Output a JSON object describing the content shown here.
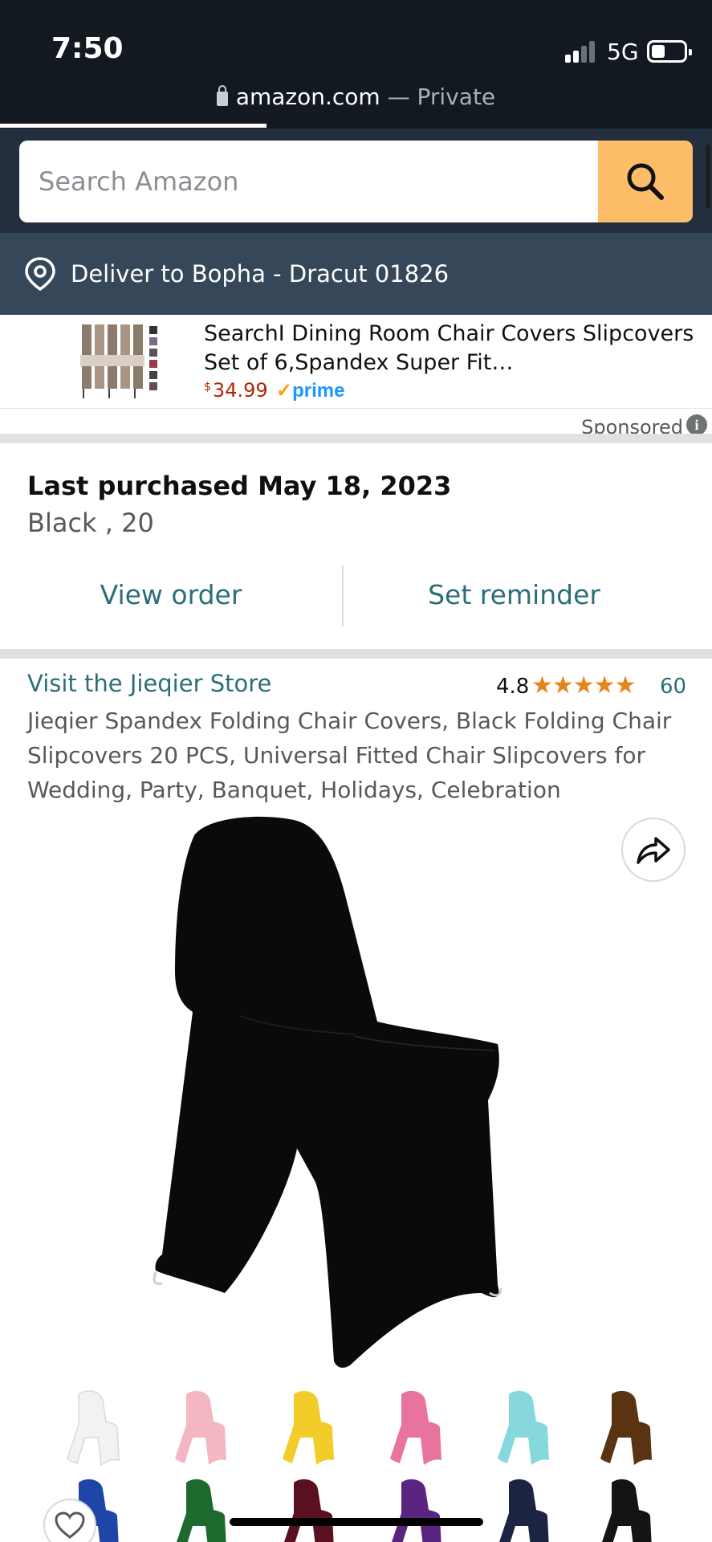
{
  "status_bar": {
    "time": "7:50",
    "network": "5G",
    "url": "amazon.com",
    "url_suffix": "— Private"
  },
  "search": {
    "placeholder": "Search Amazon",
    "icon": "search-icon",
    "button_color": "#febd69"
  },
  "deliver": {
    "text": "Deliver to Bopha - Dracut 01826",
    "icon": "location-pin-icon"
  },
  "sponsored_ad": {
    "title": "SearchI Dining Room Chair Covers Slipcovers Set of 6,Spandex Super Fit…",
    "currency": "$",
    "price": "34.99",
    "prime_check": "✓",
    "prime_label": "prime",
    "sponsored_label": "Sponsored",
    "info_icon": "i"
  },
  "last_purchased": {
    "title": "Last purchased May 18, 2023",
    "variant": "Black , 20",
    "view_order": "View order",
    "set_reminder": "Set reminder"
  },
  "product": {
    "store_link": "Visit the Jieqier Store",
    "rating": "4.8",
    "stars": "★★★★★",
    "rating_value": 4.8,
    "rating_count": "60",
    "title": "Jieqier Spandex Folding Chair Covers, Black Folding Chair Slipcovers 20 PCS, Universal Fitted Chair Slipcovers for Wedding, Party, Banquet, Holidays, Celebration",
    "main_color": "#0a0a0a"
  },
  "colors": {
    "brand_dark": "#131921",
    "search_bar_bg": "#232f3e",
    "deliver_bg": "#37475a",
    "link": "#2c6e78",
    "star": "#e6851b",
    "price": "#b12704"
  },
  "swatches": [
    {
      "name": "white",
      "color": "#f2f2f2"
    },
    {
      "name": "pink",
      "color": "#f4b6c2"
    },
    {
      "name": "yellow",
      "color": "#f2cd2a"
    },
    {
      "name": "rose",
      "color": "#e8739f"
    },
    {
      "name": "aqua",
      "color": "#86d8dc"
    },
    {
      "name": "brown",
      "color": "#5a3412"
    },
    {
      "name": "royal-blue",
      "color": "#1f45a8"
    },
    {
      "name": "green",
      "color": "#1e6a2e"
    },
    {
      "name": "burgundy",
      "color": "#5a1021"
    },
    {
      "name": "purple",
      "color": "#5a2580"
    },
    {
      "name": "navy",
      "color": "#1b2440"
    },
    {
      "name": "black",
      "color": "#141414"
    }
  ]
}
